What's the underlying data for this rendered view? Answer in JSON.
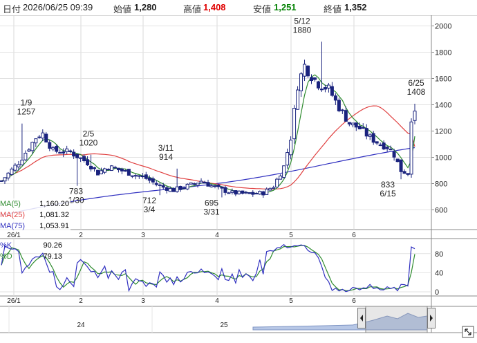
{
  "header": {
    "date_label": "日付",
    "date_value": "2026/06/25 09:39",
    "open_label": "始値",
    "open_value": "1,280",
    "high_label": "高値",
    "high_value": "1,408",
    "low_label": "安値",
    "low_value": "1,251",
    "close_label": "終値",
    "close_value": "1,352",
    "colors": {
      "high": "#e00000",
      "low": "#008000",
      "text": "#222222"
    }
  },
  "legend": {
    "ma5": {
      "label": "MA(5)",
      "value": "1,160.20",
      "color": "#2e8b2e"
    },
    "ma25": {
      "label": "MA(25)",
      "value": "1,081.32",
      "color": "#e04040"
    },
    "ma75": {
      "label": "MA(75)",
      "value": "1,053.91",
      "color": "#3030c0"
    },
    "k": {
      "label": "%K",
      "value": "90.26",
      "color": "#3030c0"
    },
    "d": {
      "label": "%D",
      "value": "79.13",
      "color": "#2e8b2e"
    }
  },
  "annotations": [
    {
      "date": "1/9",
      "price": "1257"
    },
    {
      "date": "2/5",
      "price": "1020"
    },
    {
      "date": "3/11",
      "price": "914"
    },
    {
      "date": "5/12",
      "price": "1880"
    },
    {
      "date": "6/25",
      "price": "1408"
    },
    {
      "price": "783",
      "date": "1/30"
    },
    {
      "price": "712",
      "date": "3/4"
    },
    {
      "price": "695",
      "date": "3/31"
    },
    {
      "price": "833",
      "date": "6/15"
    }
  ],
  "navigator": {
    "labels": [
      "24",
      "25"
    ]
  },
  "chart_data": [
    {
      "type": "candlestick",
      "title": "",
      "ylim": [
        450,
        2050
      ],
      "y_ticks": [
        600,
        800,
        1000,
        1200,
        1400,
        1600,
        1800,
        2000
      ],
      "month_labels": [
        "26/1",
        "2",
        "3",
        "4",
        "5",
        "6"
      ],
      "grid": true,
      "legend": "top-left",
      "key_points": [
        {
          "date": "1/9",
          "high": 1257
        },
        {
          "date": "1/30",
          "low": 783
        },
        {
          "date": "2/5",
          "high": 1020
        },
        {
          "date": "3/4",
          "low": 712
        },
        {
          "date": "3/11",
          "high": 914
        },
        {
          "date": "3/31",
          "low": 695
        },
        {
          "date": "5/12",
          "high": 1880
        },
        {
          "date": "6/15",
          "low": 833
        },
        {
          "date": "6/25",
          "open": 1280,
          "high": 1408,
          "low": 1251,
          "close": 1352
        }
      ],
      "series": [
        {
          "name": "MA(5)",
          "last": 1160.2
        },
        {
          "name": "MA(25)",
          "last": 1081.32
        },
        {
          "name": "MA(75)",
          "last": 1053.91
        }
      ]
    },
    {
      "type": "line",
      "title": "",
      "ylim": [
        0,
        100
      ],
      "y_ticks": [
        0,
        40,
        80
      ],
      "month_labels": [
        "26/1",
        "2",
        "3",
        "4",
        "5",
        "6"
      ],
      "series": [
        {
          "name": "%K",
          "last": 90.26
        },
        {
          "name": "%D",
          "last": 79.13
        }
      ]
    }
  ]
}
